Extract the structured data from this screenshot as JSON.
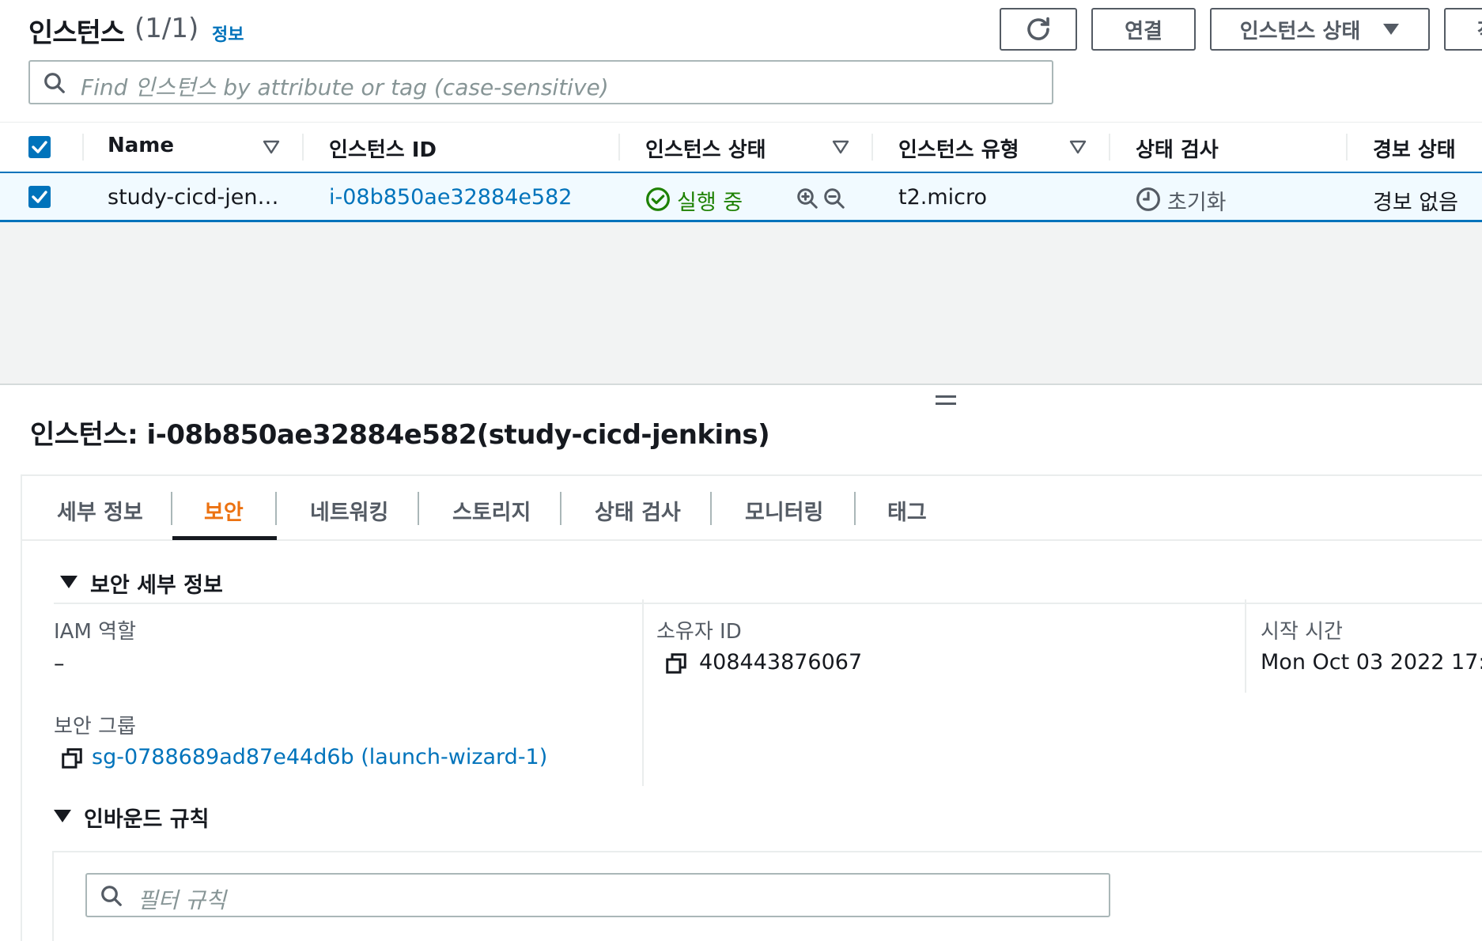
{
  "header": {
    "title": "인스턴스",
    "count": "(1/1)",
    "info_link": "정보",
    "connect_button": "연결",
    "state_button": "인스턴스 상태",
    "more_button_partial": "작"
  },
  "search": {
    "placeholder": "Find 인스턴스 by attribute or tag (case-sensitive)"
  },
  "table": {
    "columns": [
      "Name",
      "인스턴스 ID",
      "인스턴스 상태",
      "인스턴스 유형",
      "상태 검사",
      "경보 상태"
    ],
    "row": {
      "name": "study-cicd-jen…",
      "instance_id": "i-08b850ae32884e582",
      "state": "실행 중",
      "type": "t2.micro",
      "status_check": "초기화",
      "alarm": "경보 없음"
    }
  },
  "details": {
    "title": "인스턴스: i-08b850ae32884e582(study-cicd-jenkins)",
    "tabs": [
      "세부 정보",
      "보안",
      "네트워킹",
      "스토리지",
      "상태 검사",
      "모니터링",
      "태그"
    ],
    "active_tab": "보안",
    "security_section": {
      "heading": "보안 세부 정보",
      "iam_role_label": "IAM 역할",
      "iam_role_value": "–",
      "owner_id_label": "소유자 ID",
      "owner_id_value": "408443876067",
      "launch_time_label": "시작 시간",
      "launch_time_value": "Mon Oct 03 2022 17:0",
      "security_group_label": "보안 그룹",
      "security_group_value": "sg-0788689ad87e44d6b (launch-wizard-1)"
    },
    "inbound_section": {
      "heading": "인바운드 규칙",
      "filter_placeholder": "필터 규칙"
    }
  },
  "colors": {
    "link": "#0073bb",
    "running": "#1d8102",
    "active_tab": "#ec7211",
    "selected_row_bg": "#f1faff"
  }
}
